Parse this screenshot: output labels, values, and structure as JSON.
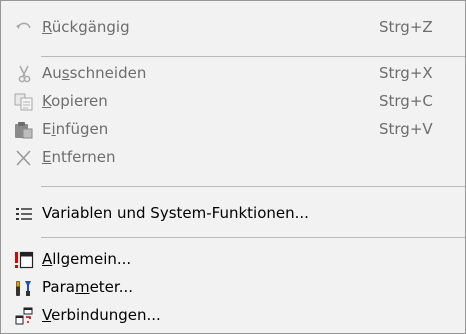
{
  "menu": {
    "items": [
      {
        "icon": "undo-icon",
        "pre": "",
        "ul": "R",
        "post": "ückgängig",
        "shortcut": "Strg+Z",
        "enabled": false
      },
      {
        "icon": "scissors-icon",
        "pre": "Au",
        "ul": "s",
        "post": "schneiden",
        "shortcut": "Strg+X",
        "enabled": false
      },
      {
        "icon": "copy-icon",
        "pre": "",
        "ul": "K",
        "post": "opieren",
        "shortcut": "Strg+C",
        "enabled": false
      },
      {
        "icon": "paste-icon",
        "pre": "E",
        "ul": "i",
        "post": "nfügen",
        "shortcut": "Strg+V",
        "enabled": false
      },
      {
        "icon": "delete-x-icon",
        "pre": "",
        "ul": "E",
        "post": "ntfernen",
        "shortcut": "",
        "enabled": false
      },
      {
        "icon": "variables-list-icon",
        "pre": "Variablen und System-Funktionen...",
        "ul": "",
        "post": "",
        "shortcut": "",
        "enabled": true
      },
      {
        "icon": "window-exclamation-icon",
        "pre": "",
        "ul": "A",
        "post": "llgemein...",
        "shortcut": "",
        "enabled": true
      },
      {
        "icon": "tools-icon",
        "pre": "Para",
        "ul": "m",
        "post": "eter...",
        "shortcut": "",
        "enabled": true
      },
      {
        "icon": "connections-icon",
        "pre": "",
        "ul": "V",
        "post": "erbindungen...",
        "shortcut": "",
        "enabled": true
      }
    ]
  }
}
